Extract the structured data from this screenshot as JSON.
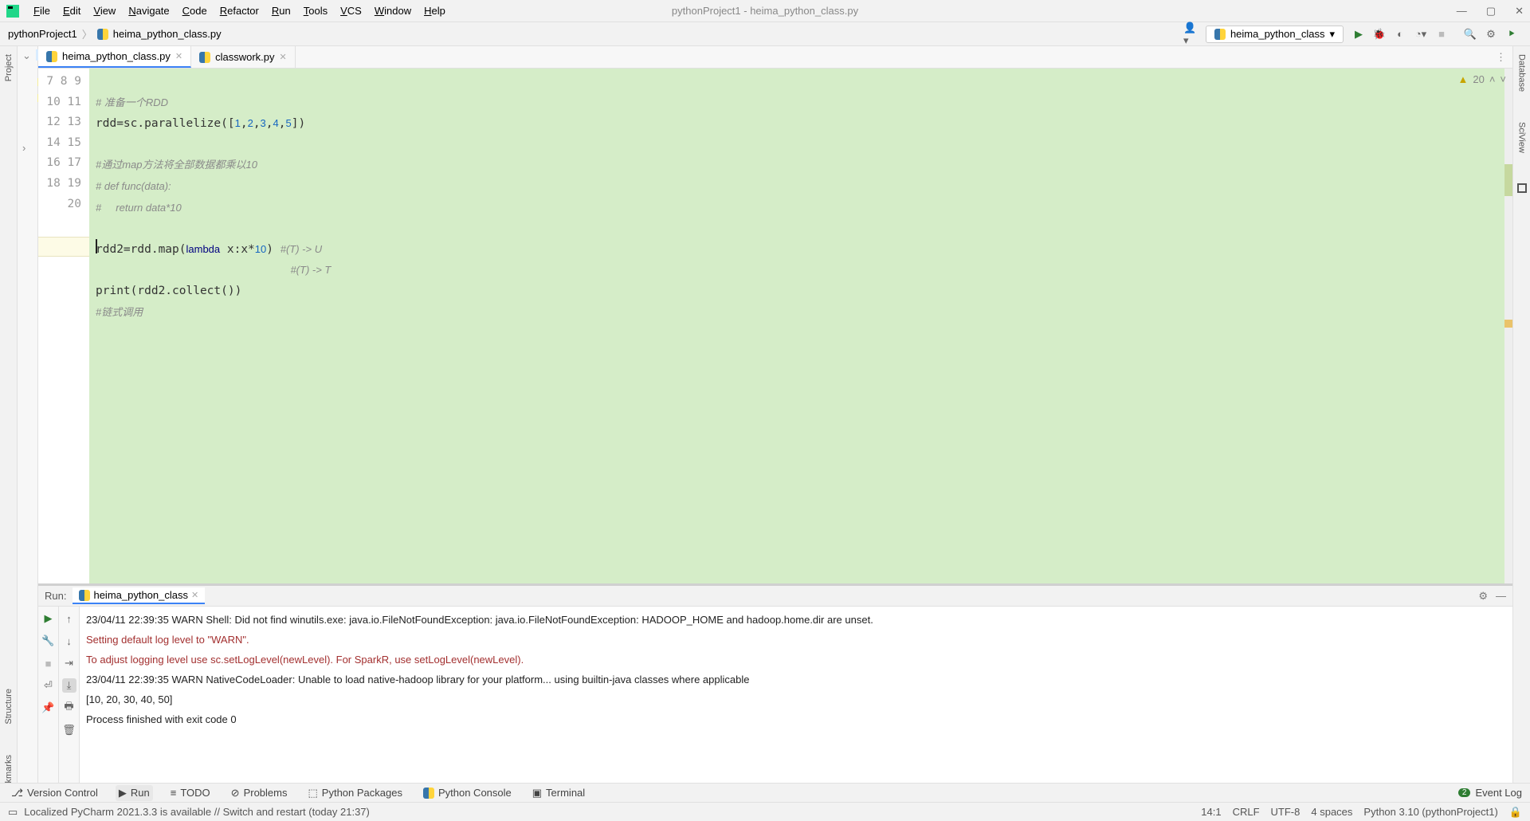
{
  "window_title": "pythonProject1 - heima_python_class.py",
  "menubar": [
    "File",
    "Edit",
    "View",
    "Navigate",
    "Code",
    "Refactor",
    "Run",
    "Tools",
    "VCS",
    "Window",
    "Help"
  ],
  "breadcrumb": {
    "items": [
      "pythonProject1",
      "heima_python_class.py"
    ]
  },
  "run_config": "heima_python_class",
  "leftrail": {
    "project": "Project",
    "structure": "Structure",
    "bookmarks": "Bookmarks"
  },
  "rightrail": {
    "database": "Database",
    "sciview": "SciView"
  },
  "tabs": [
    {
      "name": "heima_python_class.py",
      "active": true
    },
    {
      "name": "classwork.py",
      "active": false
    }
  ],
  "editor": {
    "warning_count": "20",
    "first_line_no": 7,
    "lines": [
      {
        "n": "7",
        "raw": "",
        "seg": []
      },
      {
        "n": "8",
        "raw": "# 准备一个RDD",
        "seg": [
          {
            "cls": "c-comment",
            "t": "# 准备一个RDD"
          }
        ]
      },
      {
        "n": "9",
        "raw": "rdd=sc.parallelize([1,2,3,4,5])",
        "seg": [
          {
            "t": "rdd=sc.parallelize(["
          },
          {
            "cls": "c-num",
            "t": "1"
          },
          {
            "t": ","
          },
          {
            "cls": "c-num",
            "t": "2"
          },
          {
            "t": ","
          },
          {
            "cls": "c-num",
            "t": "3"
          },
          {
            "t": ","
          },
          {
            "cls": "c-num",
            "t": "4"
          },
          {
            "t": ","
          },
          {
            "cls": "c-num",
            "t": "5"
          },
          {
            "t": "])"
          }
        ]
      },
      {
        "n": "10",
        "raw": "",
        "seg": []
      },
      {
        "n": "11",
        "raw": "#通过map方法将全部数据都乘以10",
        "seg": [
          {
            "cls": "c-comment",
            "t": "#通过map方法将全部数据都乘以10"
          }
        ]
      },
      {
        "n": "12",
        "raw": "# def func(data):",
        "seg": [
          {
            "cls": "c-comment",
            "t": "# def func(data):"
          }
        ]
      },
      {
        "n": "13",
        "raw": "#     return data*10",
        "seg": [
          {
            "cls": "c-comment",
            "t": "#     return data*10"
          }
        ]
      },
      {
        "n": "14",
        "raw": "",
        "seg": []
      },
      {
        "n": "15",
        "raw": "rdd2=rdd.map(lambda x:x*10) #(T) -> U",
        "seg": [
          {
            "t": "rdd2=rdd.map("
          },
          {
            "cls": "c-kw",
            "t": "lambda"
          },
          {
            "t": " x:x*"
          },
          {
            "cls": "c-num",
            "t": "10"
          },
          {
            "t": ") "
          },
          {
            "cls": "c-comment",
            "t": "#(T) -> U"
          }
        ]
      },
      {
        "n": "16",
        "raw": "                            #(T) -> T",
        "seg": [
          {
            "t": "                            "
          },
          {
            "cls": "c-comment",
            "t": "#(T) -> T"
          }
        ]
      },
      {
        "n": "17",
        "raw": "print(rdd2.collect())",
        "seg": [
          {
            "t": "print(rdd2.collect())"
          }
        ]
      },
      {
        "n": "18",
        "raw": "#链式调用",
        "seg": [
          {
            "cls": "c-comment",
            "t": "#链式调用"
          }
        ]
      },
      {
        "n": "19",
        "raw": "",
        "seg": []
      },
      {
        "n": "20",
        "raw": "",
        "seg": []
      }
    ],
    "cursor_line": 14
  },
  "run_panel": {
    "label": "Run:",
    "tab": "heima_python_class",
    "output": [
      {
        "cls": "norm",
        "t": "23/04/11 22:39:35 WARN Shell: Did not find winutils.exe: java.io.FileNotFoundException: java.io.FileNotFoundException: HADOOP_HOME and hadoop.home.dir are unset."
      },
      {
        "cls": "red",
        "t": "Setting default log level to \"WARN\"."
      },
      {
        "cls": "red",
        "t": "To adjust logging level use sc.setLogLevel(newLevel). For SparkR, use setLogLevel(newLevel)."
      },
      {
        "cls": "norm",
        "t": "23/04/11 22:39:35 WARN NativeCodeLoader: Unable to load native-hadoop library for your platform... using builtin-java classes where applicable"
      },
      {
        "cls": "norm",
        "t": "[10, 20, 30, 40, 50]"
      },
      {
        "cls": "norm",
        "t": ""
      },
      {
        "cls": "norm",
        "t": "Process finished with exit code 0"
      }
    ]
  },
  "bottom_tabs": {
    "version_control": "Version Control",
    "run": "Run",
    "todo": "TODO",
    "problems": "Problems",
    "python_packages": "Python Packages",
    "python_console": "Python Console",
    "terminal": "Terminal",
    "event_log": "Event Log",
    "event_badge": "2"
  },
  "statusbar": {
    "msg": "Localized PyCharm 2021.3.3 is available // Switch and restart (today 21:37)",
    "position": "14:1",
    "line_sep": "CRLF",
    "encoding": "UTF-8",
    "indent": "4 spaces",
    "interpreter": "Python 3.10 (pythonProject1)"
  }
}
